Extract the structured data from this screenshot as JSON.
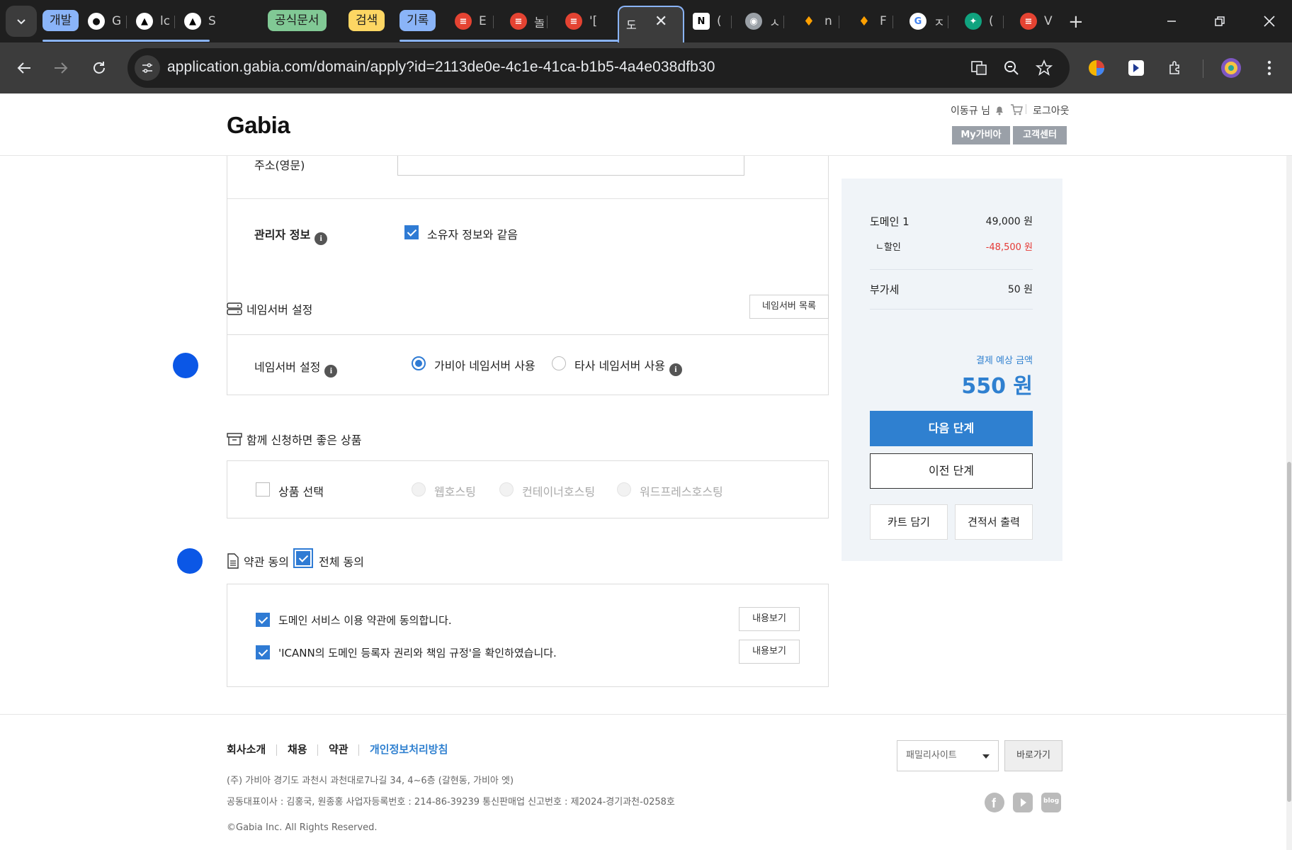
{
  "browser": {
    "tab_groups": [
      {
        "label": "개발",
        "color": "#8ab4f8",
        "text_color": "#1f1f1f"
      },
      {
        "label": "공식문서",
        "color": "#81c995",
        "text_color": "#1f1f1f"
      },
      {
        "label": "검색",
        "color": "#fdd663",
        "text_color": "#1f1f1f"
      },
      {
        "label": "기록",
        "color": "#8ab4f8",
        "text_color": "#1f1f1f"
      }
    ],
    "tabs": [
      {
        "icon": "github-icon",
        "title": "G"
      },
      {
        "icon": "vercel-icon",
        "title": "lc"
      },
      {
        "icon": "vercel-icon",
        "title": "S"
      },
      {
        "icon": "todoist-icon",
        "title": "E"
      },
      {
        "icon": "todoist-icon",
        "title": "놀"
      },
      {
        "icon": "todoist-icon",
        "title": "'["
      },
      {
        "icon": "gabia-icon",
        "title": "도"
      },
      {
        "icon": "notion-icon",
        "title": "("
      },
      {
        "icon": "chrome-icon",
        "title": "ㅅ"
      },
      {
        "icon": "firebase-icon",
        "title": "n"
      },
      {
        "icon": "firebase-icon",
        "title": "F"
      },
      {
        "icon": "google-icon",
        "title": "ㅈ"
      },
      {
        "icon": "chatgpt-icon",
        "title": "("
      },
      {
        "icon": "todoist-icon",
        "title": "V"
      }
    ],
    "url": "application.gabia.com/domain/apply?id=2113de0e-4c1e-41ca-b1b5-4a4e038dfb30"
  },
  "header": {
    "logo": "Gabia",
    "user": "이동규 님",
    "logout": "로그아웃",
    "my_gabia": "My가비아",
    "support": "고객센터"
  },
  "form": {
    "address_label": "주소(영문)",
    "admin_label": "관리자 정보",
    "admin_same": "소유자 정보와 같음",
    "ns_section_title": "네임서버 설정",
    "ns_list_button": "네임서버 목록",
    "ns_label": "네임서버 설정",
    "ns_option_gabia": "가비아 네임서버 사용",
    "ns_option_other": "타사 네임서버 사용",
    "addon_section_title": "함께 신청하면 좋은 상품",
    "addon_label": "상품 선택",
    "addon_options": [
      "웹호스팅",
      "컨테이너호스팅",
      "워드프레스호스팅"
    ],
    "terms_section_title": "약관 동의",
    "terms_all": "전체 동의",
    "terms": [
      {
        "text": "도메인 서비스 이용 약관에 동의합니다.",
        "button": "내용보기"
      },
      {
        "text": "'ICANN의 도메인 등록자 권리와 책임 규정'을 확인하였습니다.",
        "button": "내용보기"
      }
    ]
  },
  "summary": {
    "domain_label": "도메인 1",
    "domain_price": "49,000 원",
    "discount_label": "ㄴ할인",
    "discount_value": "-48,500 원",
    "vat_label": "부가세",
    "vat_value": "50 원",
    "total_label": "결제 예상 금액",
    "total_value": "550 원",
    "next": "다음 단계",
    "prev": "이전 단계",
    "cart": "카트 담기",
    "quote": "견적서 출력",
    "accent": "#2f80d0",
    "discount_color": "#e53935"
  },
  "footer": {
    "links": [
      "회사소개",
      "채용",
      "약관",
      "개인정보처리방침"
    ],
    "address": "(주) 가비아    경기도 과천시 과천대로7나길 34, 4~6층 (갈현동, 가비아 엣)",
    "registry": "공동대표이사 : 김홍국, 원종홍    사업자등록번호 : 214-86-39239    통신판매업 신고번호 : 제2024-경기과천-0258호",
    "copyright": "©Gabia Inc. All Rights Reserved.",
    "family_site": "패밀리사이트",
    "go": "바로가기",
    "blog": "blog"
  }
}
